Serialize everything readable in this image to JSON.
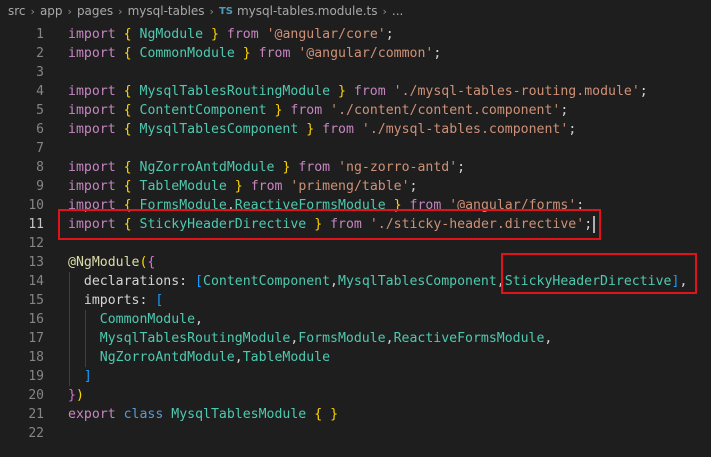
{
  "breadcrumb": {
    "items": [
      "src",
      "app",
      "pages",
      "mysql-tables"
    ],
    "file_badge": "TS",
    "file": "mysql-tables.module.ts",
    "ellipsis": "..."
  },
  "editor": {
    "active_line": 11,
    "lines": [
      {
        "n": "1",
        "tokens": [
          [
            "import",
            "k-import"
          ],
          [
            " ",
            ""
          ],
          [
            "{",
            "t-brace"
          ],
          [
            " ",
            ""
          ],
          [
            "NgModule",
            "t-class"
          ],
          [
            " ",
            ""
          ],
          [
            "}",
            "t-brace"
          ],
          [
            " ",
            ""
          ],
          [
            "from",
            "k-import"
          ],
          [
            " ",
            ""
          ],
          [
            "'@angular/core'",
            "t-str"
          ],
          [
            ";",
            "t-punc"
          ]
        ]
      },
      {
        "n": "2",
        "tokens": [
          [
            "import",
            "k-import"
          ],
          [
            " ",
            ""
          ],
          [
            "{",
            "t-brace"
          ],
          [
            " ",
            ""
          ],
          [
            "CommonModule",
            "t-class"
          ],
          [
            " ",
            ""
          ],
          [
            "}",
            "t-brace"
          ],
          [
            " ",
            ""
          ],
          [
            "from",
            "k-import"
          ],
          [
            " ",
            ""
          ],
          [
            "'@angular/common'",
            "t-str"
          ],
          [
            ";",
            "t-punc"
          ]
        ]
      },
      {
        "n": "3",
        "tokens": []
      },
      {
        "n": "4",
        "tokens": [
          [
            "import",
            "k-import"
          ],
          [
            " ",
            ""
          ],
          [
            "{",
            "t-brace"
          ],
          [
            " ",
            ""
          ],
          [
            "MysqlTablesRoutingModule",
            "t-class"
          ],
          [
            " ",
            ""
          ],
          [
            "}",
            "t-brace"
          ],
          [
            " ",
            ""
          ],
          [
            "from",
            "k-import"
          ],
          [
            " ",
            ""
          ],
          [
            "'./mysql-tables-routing.module'",
            "t-str"
          ],
          [
            ";",
            "t-punc"
          ]
        ]
      },
      {
        "n": "5",
        "tokens": [
          [
            "import",
            "k-import"
          ],
          [
            " ",
            ""
          ],
          [
            "{",
            "t-brace"
          ],
          [
            " ",
            ""
          ],
          [
            "ContentComponent",
            "t-class"
          ],
          [
            " ",
            ""
          ],
          [
            "}",
            "t-brace"
          ],
          [
            " ",
            ""
          ],
          [
            "from",
            "k-import"
          ],
          [
            " ",
            ""
          ],
          [
            "'./content/content.component'",
            "t-str"
          ],
          [
            ";",
            "t-punc"
          ]
        ]
      },
      {
        "n": "6",
        "tokens": [
          [
            "import",
            "k-import"
          ],
          [
            " ",
            ""
          ],
          [
            "{",
            "t-brace"
          ],
          [
            " ",
            ""
          ],
          [
            "MysqlTablesComponent",
            "t-class"
          ],
          [
            " ",
            ""
          ],
          [
            "}",
            "t-brace"
          ],
          [
            " ",
            ""
          ],
          [
            "from",
            "k-import"
          ],
          [
            " ",
            ""
          ],
          [
            "'./mysql-tables.component'",
            "t-str"
          ],
          [
            ";",
            "t-punc"
          ]
        ]
      },
      {
        "n": "7",
        "tokens": []
      },
      {
        "n": "8",
        "tokens": [
          [
            "import",
            "k-import"
          ],
          [
            " ",
            ""
          ],
          [
            "{",
            "t-brace"
          ],
          [
            " ",
            ""
          ],
          [
            "NgZorroAntdModule",
            "t-class"
          ],
          [
            " ",
            ""
          ],
          [
            "}",
            "t-brace"
          ],
          [
            " ",
            ""
          ],
          [
            "from",
            "k-import"
          ],
          [
            " ",
            ""
          ],
          [
            "'ng-zorro-antd'",
            "t-str"
          ],
          [
            ";",
            "t-punc"
          ]
        ]
      },
      {
        "n": "9",
        "tokens": [
          [
            "import",
            "k-import"
          ],
          [
            " ",
            ""
          ],
          [
            "{",
            "t-brace"
          ],
          [
            " ",
            ""
          ],
          [
            "TableModule",
            "t-class"
          ],
          [
            " ",
            ""
          ],
          [
            "}",
            "t-brace"
          ],
          [
            " ",
            ""
          ],
          [
            "from",
            "k-import"
          ],
          [
            " ",
            ""
          ],
          [
            "'primeng/table'",
            "t-str"
          ],
          [
            ";",
            "t-punc"
          ]
        ]
      },
      {
        "n": "10",
        "tokens": [
          [
            "import",
            "k-import"
          ],
          [
            " ",
            ""
          ],
          [
            "{",
            "t-brace"
          ],
          [
            " ",
            ""
          ],
          [
            "FormsModule",
            "t-class"
          ],
          [
            ",",
            "t-punc"
          ],
          [
            "ReactiveFormsModule",
            "t-class"
          ],
          [
            " ",
            ""
          ],
          [
            "}",
            "t-brace"
          ],
          [
            " ",
            ""
          ],
          [
            "from",
            "k-import"
          ],
          [
            " ",
            ""
          ],
          [
            "'@angular/forms'",
            "t-str"
          ],
          [
            ";",
            "t-punc"
          ]
        ]
      },
      {
        "n": "11",
        "tokens": [
          [
            "import",
            "k-import"
          ],
          [
            " ",
            ""
          ],
          [
            "{",
            "t-brace"
          ],
          [
            " ",
            ""
          ],
          [
            "StickyHeaderDirective",
            "t-class"
          ],
          [
            " ",
            ""
          ],
          [
            "}",
            "t-brace"
          ],
          [
            " ",
            ""
          ],
          [
            "from",
            "k-import"
          ],
          [
            " ",
            ""
          ],
          [
            "'./sticky-header.directive'",
            "t-str"
          ],
          [
            ";",
            "t-punc"
          ]
        ]
      },
      {
        "n": "12",
        "tokens": []
      },
      {
        "n": "13",
        "tokens": [
          [
            "@NgModule",
            "t-dec"
          ],
          [
            "(",
            "t-brace"
          ],
          [
            "{",
            "t-paren"
          ]
        ]
      },
      {
        "n": "14",
        "tokens": [
          [
            "  declarations: ",
            "t-punc"
          ],
          [
            "[",
            "t-bracket"
          ],
          [
            "ContentComponent",
            "t-class"
          ],
          [
            ",",
            "t-punc"
          ],
          [
            "MysqlTablesComponent",
            "t-class"
          ],
          [
            ",",
            "t-punc"
          ],
          [
            "StickyHeaderDirective",
            "t-class"
          ],
          [
            "]",
            "t-bracket"
          ],
          [
            ",",
            "t-punc"
          ]
        ]
      },
      {
        "n": "15",
        "tokens": [
          [
            "  imports: ",
            "t-punc"
          ],
          [
            "[",
            "t-bracket"
          ]
        ]
      },
      {
        "n": "16",
        "tokens": [
          [
            "    CommonModule",
            "t-class"
          ],
          [
            ",",
            "t-punc"
          ]
        ]
      },
      {
        "n": "17",
        "tokens": [
          [
            "    MysqlTablesRoutingModule",
            "t-class"
          ],
          [
            ",",
            "t-punc"
          ],
          [
            "FormsModule",
            "t-class"
          ],
          [
            ",",
            "t-punc"
          ],
          [
            "ReactiveFormsModule",
            "t-class"
          ],
          [
            ",",
            "t-punc"
          ]
        ]
      },
      {
        "n": "18",
        "tokens": [
          [
            "    NgZorroAntdModule",
            "t-class"
          ],
          [
            ",",
            "t-punc"
          ],
          [
            "TableModule",
            "t-class"
          ]
        ]
      },
      {
        "n": "19",
        "tokens": [
          [
            "  ",
            "t-punc"
          ],
          [
            "]",
            "t-bracket"
          ]
        ]
      },
      {
        "n": "20",
        "tokens": [
          [
            "}",
            "t-paren"
          ],
          [
            ")",
            "t-brace"
          ]
        ]
      },
      {
        "n": "21",
        "tokens": [
          [
            "export",
            "k-import"
          ],
          [
            " ",
            ""
          ],
          [
            "class",
            "k-kw"
          ],
          [
            " ",
            ""
          ],
          [
            "MysqlTablesModule",
            "t-class"
          ],
          [
            " ",
            ""
          ],
          [
            "{",
            "t-brace"
          ],
          [
            " ",
            ""
          ],
          [
            "}",
            "t-brace"
          ]
        ]
      },
      {
        "n": "22",
        "tokens": []
      }
    ]
  },
  "highlights": [
    {
      "name": "highlight-box-import-line",
      "line": 11
    },
    {
      "name": "highlight-box-declaration",
      "line": 14
    }
  ],
  "colors": {
    "background": "#1e1e1e",
    "highlight_box": "#e0131a"
  }
}
